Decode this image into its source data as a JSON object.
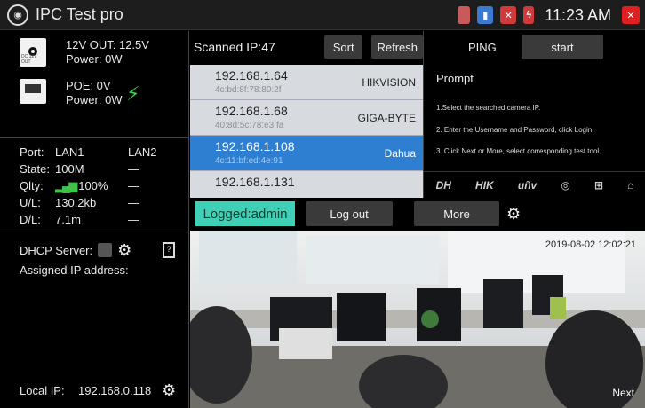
{
  "app": {
    "title": "IPC Test pro",
    "logo_icon": "camera-icon"
  },
  "status_bar": {
    "time": "11:23 AM"
  },
  "power": {
    "dc_label": "DC 12V OUT",
    "output": "12V OUT: 12.5V",
    "power": "Power: 0W",
    "lan_label": "LAN",
    "poe": "POE: 0V",
    "poe_power": "Power: 0W"
  },
  "stats": {
    "rows": [
      {
        "k": "Port:",
        "v1": "LAN1",
        "v2": "LAN2"
      },
      {
        "k": "State:",
        "v1": "100M",
        "v2": "—"
      },
      {
        "k": "Qlty:",
        "v1": "100%",
        "v2": "—"
      },
      {
        "k": "U/L:",
        "v1": "130.2kb",
        "v2": "—"
      },
      {
        "k": "D/L:",
        "v1": "7.1m",
        "v2": "—"
      }
    ]
  },
  "dhcp": {
    "label": "DHCP Server:",
    "assigned": "Assigned IP address:"
  },
  "local": {
    "label": "Local IP:",
    "ip": "192.168.0.118"
  },
  "scan": {
    "title": "Scanned IP:47",
    "sort": "Sort",
    "refresh": "Refresh",
    "devices": [
      {
        "ip": "192.168.1.64",
        "mac": "4c:bd:8f:78:80:2f",
        "brand": "HIKVISION"
      },
      {
        "ip": "192.168.1.68",
        "mac": "40:8d:5c:78:e3:fa",
        "brand": "GIGA-BYTE"
      },
      {
        "ip": "192.168.1.108",
        "mac": "4c:11:bf:ed:4e:91",
        "brand": "Dahua"
      },
      {
        "ip": "192.168.1.131",
        "mac": "",
        "brand": ""
      }
    ]
  },
  "ping": {
    "label": "PING",
    "start": "start"
  },
  "prompt": {
    "title": "Prompt",
    "lines": [
      "1.Select the searched camera IP.",
      "2. Enter the Username and Password, click Login.",
      "3. Click Next or More, select corresponding test tool."
    ]
  },
  "brands": [
    "DH",
    "HIK",
    "uñv"
  ],
  "actions": {
    "logged": "Logged:admin",
    "logout": "Log out",
    "more": "More"
  },
  "video": {
    "timestamp": "2019-08-02 12:02:21",
    "next": "Next"
  }
}
